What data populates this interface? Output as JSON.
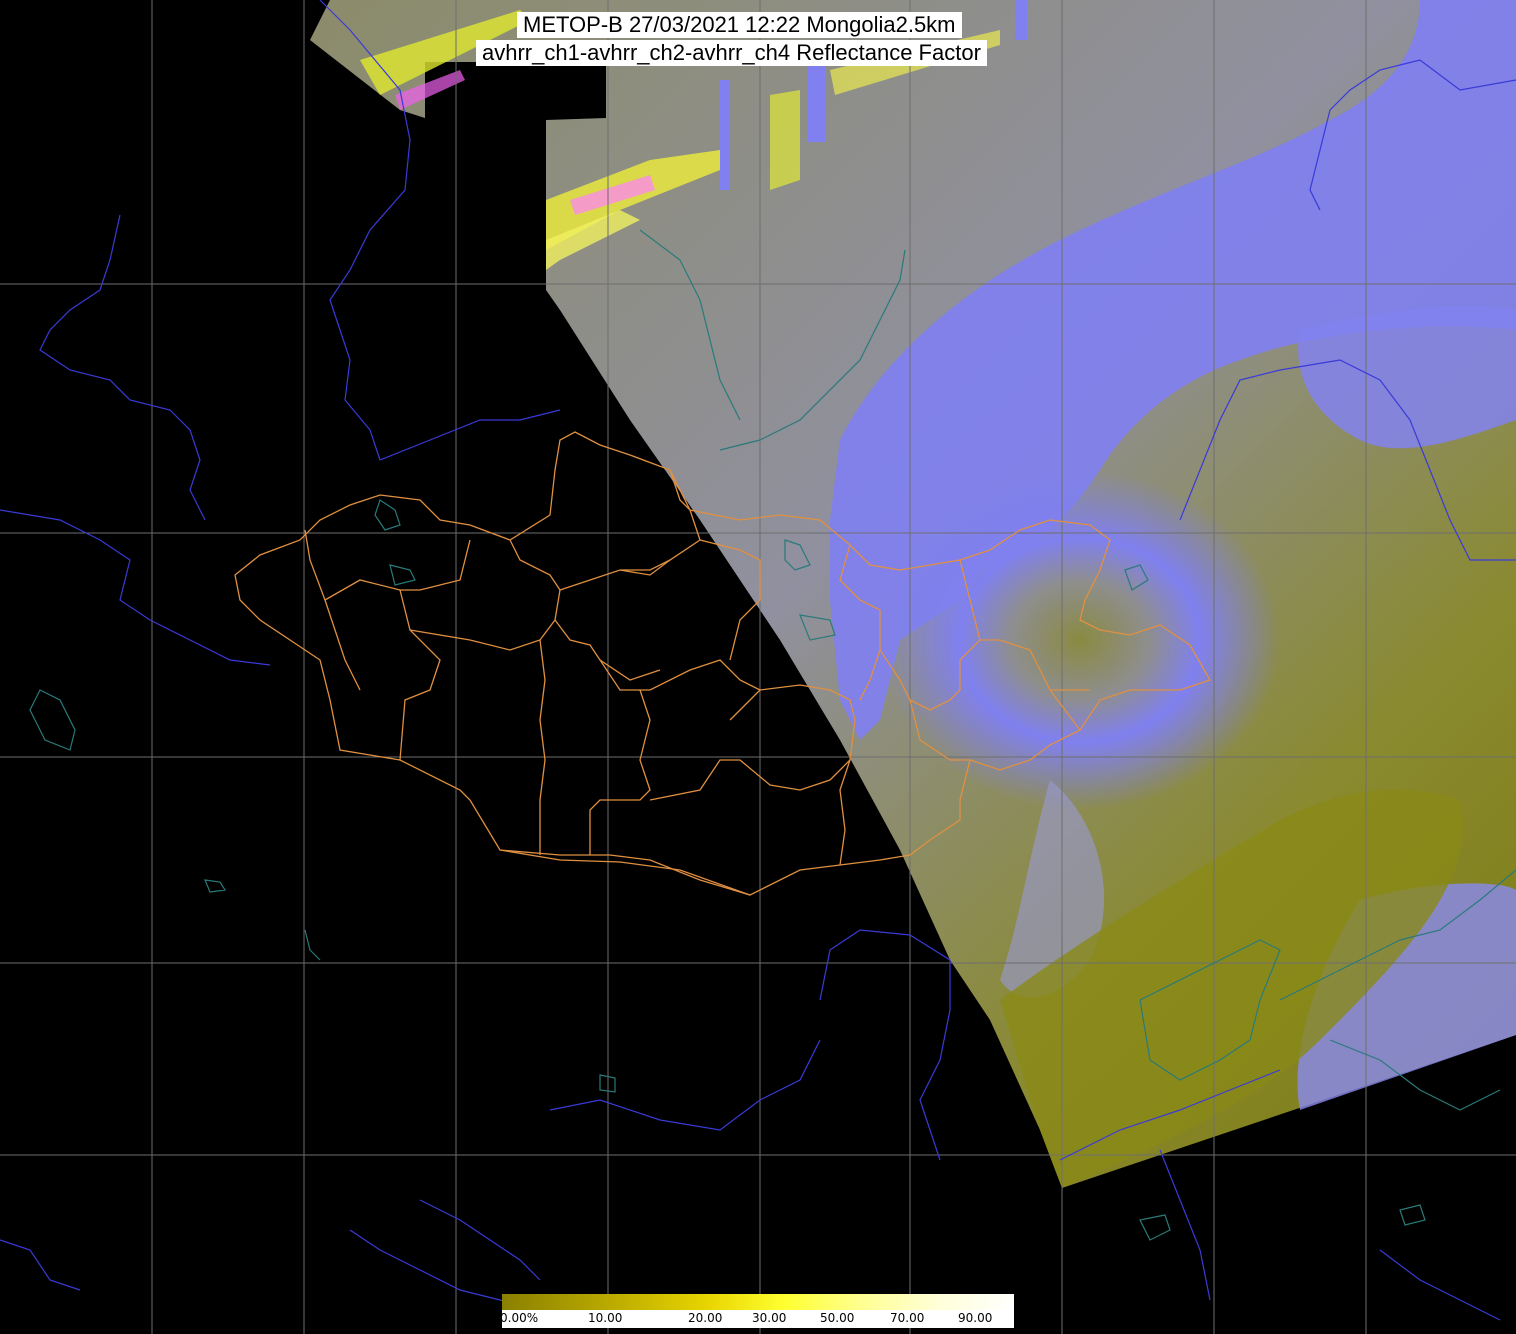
{
  "title": {
    "line1": "METOP-B 27/03/2021 12:22 Mongolia2.5km",
    "line2": "avhrr_ch1-avhrr_ch2-avhrr_ch4 Reflectance Factor"
  },
  "legend": {
    "ticks": [
      "0.00%",
      "10.00",
      "20.00",
      "30.00",
      "50.00",
      "70.00",
      "90.00"
    ],
    "colors": [
      "#8a8000",
      "#b8a800",
      "#e8d400",
      "#ffff30",
      "#ffff90",
      "#ffffd8",
      "#ffffff"
    ]
  },
  "colors": {
    "background": "#000000",
    "graticule": "#6e6e6e",
    "rivers": "#3a3ad8",
    "coast": "#2a7a7a",
    "mongolia_aimag_borders": "#e09040",
    "cloud_lavender": "#8080f8",
    "ground_olive": "#8a8a18"
  },
  "icons": [
    "graticule-grid",
    "river-lines",
    "aimag-border-lines",
    "cloud-swath"
  ]
}
